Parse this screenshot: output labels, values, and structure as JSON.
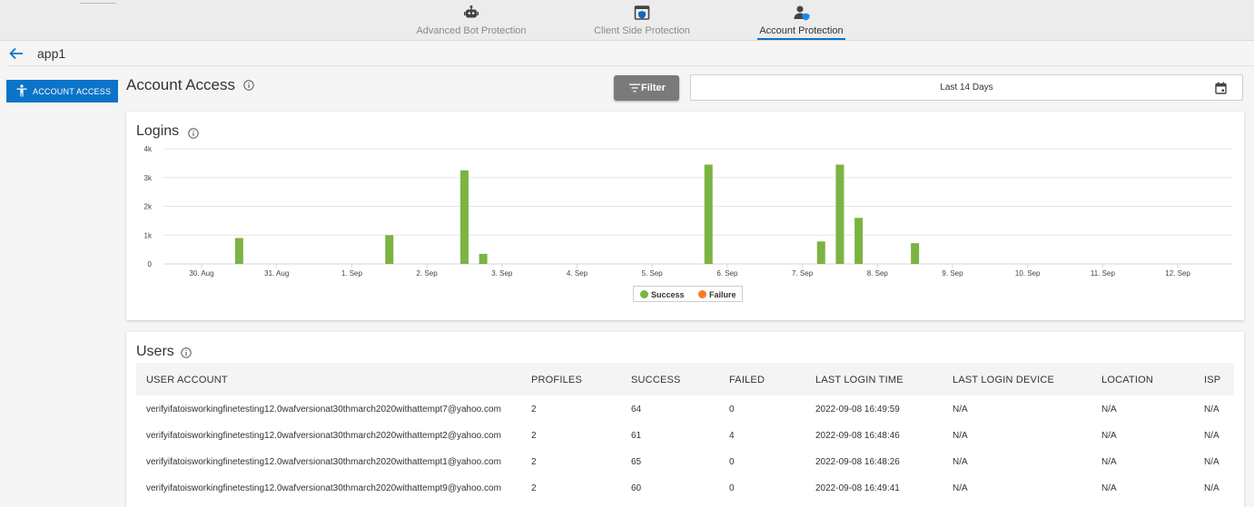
{
  "topnav": {
    "tabs": [
      {
        "label": "Advanced Bot Protection",
        "icon": "robot-icon",
        "active": false
      },
      {
        "label": "Client Side Protection",
        "icon": "browser-shield-icon",
        "active": false
      },
      {
        "label": "Account Protection",
        "icon": "user-shield-icon",
        "active": true
      }
    ]
  },
  "breadcrumb": {
    "app_name": "app1",
    "back_icon": "back-arrow-icon"
  },
  "sidebar": {
    "items": [
      {
        "label": "ACCOUNT ACCESS",
        "icon": "person-icon",
        "active": true
      }
    ]
  },
  "header": {
    "title": "Account Access",
    "filter_label": "Filter",
    "date_range": "Last 14 Days"
  },
  "colors": {
    "accent": "#0b74c9",
    "success": "#7cb342",
    "failure": "#f57c2b"
  },
  "logins": {
    "title": "Logins"
  },
  "chart_data": {
    "type": "bar",
    "title": "Logins",
    "x_ticks": [
      "30. Aug",
      "31. Aug",
      "1. Sep",
      "2. Sep",
      "3. Sep",
      "4. Sep",
      "5. Sep",
      "6. Sep",
      "7. Sep",
      "8. Sep",
      "9. Sep",
      "10. Sep",
      "11. Sep",
      "12. Sep"
    ],
    "y_ticks": [
      "0",
      "1k",
      "2k",
      "3k",
      "4k"
    ],
    "ylim": [
      0,
      4000
    ],
    "grid": true,
    "legend_position": "bottom-center",
    "series": [
      {
        "name": "Success",
        "color": "#7cb342",
        "points": [
          {
            "x": "2022-08-30 12:00",
            "y": 900
          },
          {
            "x": "2022-09-01 12:00",
            "y": 1000
          },
          {
            "x": "2022-09-02 12:00",
            "y": 3250
          },
          {
            "x": "2022-09-02 18:00",
            "y": 350
          },
          {
            "x": "2022-09-05 18:00",
            "y": 3450
          },
          {
            "x": "2022-09-07 06:00",
            "y": 780
          },
          {
            "x": "2022-09-07 12:00",
            "y": 3450
          },
          {
            "x": "2022-09-07 18:00",
            "y": 1600
          },
          {
            "x": "2022-09-08 12:00",
            "y": 720
          }
        ]
      },
      {
        "name": "Failure",
        "color": "#f57c2b",
        "points": []
      }
    ]
  },
  "users": {
    "title": "Users",
    "columns": [
      "USER ACCOUNT",
      "PROFILES",
      "SUCCESS",
      "FAILED",
      "LAST LOGIN TIME",
      "LAST LOGIN DEVICE",
      "LOCATION",
      "ISP"
    ],
    "rows": [
      [
        "verifyifatoisworkingfinetesting12.0wafversionat30thmarch2020withattempt7@yahoo.com",
        "2",
        "64",
        "0",
        "2022-09-08 16:49:59",
        "N/A",
        "N/A",
        "N/A"
      ],
      [
        "verifyifatoisworkingfinetesting12.0wafversionat30thmarch2020withattempt2@yahoo.com",
        "2",
        "61",
        "4",
        "2022-09-08 16:48:46",
        "N/A",
        "N/A",
        "N/A"
      ],
      [
        "verifyifatoisworkingfinetesting12.0wafversionat30thmarch2020withattempt1@yahoo.com",
        "2",
        "65",
        "0",
        "2022-09-08 16:48:26",
        "N/A",
        "N/A",
        "N/A"
      ],
      [
        "verifyifatoisworkingfinetesting12.0wafversionat30thmarch2020withattempt9@yahoo.com",
        "2",
        "60",
        "0",
        "2022-09-08 16:49:41",
        "N/A",
        "N/A",
        "N/A"
      ]
    ]
  }
}
